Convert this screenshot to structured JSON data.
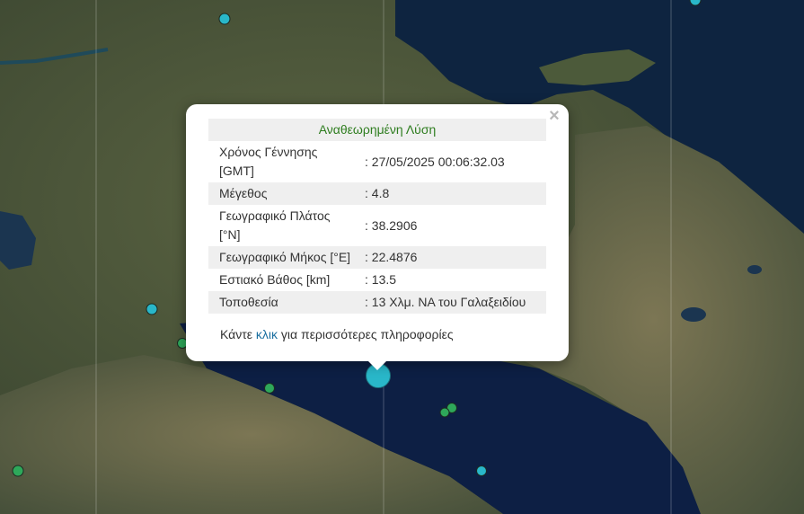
{
  "popup": {
    "title": "Αναθεωρημένη Λύση",
    "rows": [
      {
        "label": "Χρόνος Γέννησης [GMT]",
        "value": ": 27/05/2025 00:06:32.03"
      },
      {
        "label": "Μέγεθος",
        "value": ": 4.8"
      },
      {
        "label": "Γεωγραφικό Πλάτος [°N]",
        "value": ": 38.2906"
      },
      {
        "label": "Γεωγραφικό Μήκος [°E]",
        "value": ": 22.4876"
      },
      {
        "label": "Εστιακό Βάθος [km]",
        "value": ": 13.5"
      },
      {
        "label": "Τοποθεσία",
        "value": ": 13 Χλμ. ΝΑ του Γαλαξειδίου"
      }
    ],
    "footer_before": "Κάντε ",
    "footer_link": "κλικ",
    "footer_after": " για περισσότερες πληροφορίες",
    "close_symbol": "×"
  },
  "colors": {
    "marker_cyan": "#29b7c9",
    "marker_green": "#2ea85a",
    "title_green": "#2e7d1f",
    "link_blue": "#1a6fa0"
  },
  "markers": [
    {
      "type": "cyan",
      "label": "event"
    },
    {
      "type": "cyan",
      "label": "event"
    },
    {
      "type": "cyan",
      "label": "event"
    },
    {
      "type": "cyan",
      "label": "event"
    },
    {
      "type": "green",
      "label": "event"
    },
    {
      "type": "green",
      "label": "event"
    },
    {
      "type": "green",
      "label": "event"
    },
    {
      "type": "green",
      "label": "event"
    },
    {
      "type": "green",
      "label": "event"
    },
    {
      "type": "cyan",
      "label": "selected-event"
    }
  ]
}
